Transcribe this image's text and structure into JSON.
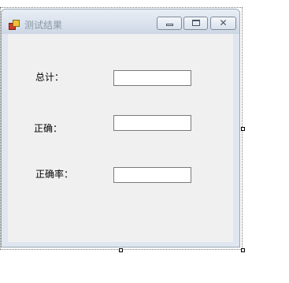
{
  "window": {
    "title": "测试结果",
    "close_glyph": "✕"
  },
  "form": {
    "total_label": "总计：",
    "correct_label": "正确：",
    "accuracy_label": "正确率：",
    "total_value": "",
    "correct_value": "",
    "accuracy_value": ""
  }
}
